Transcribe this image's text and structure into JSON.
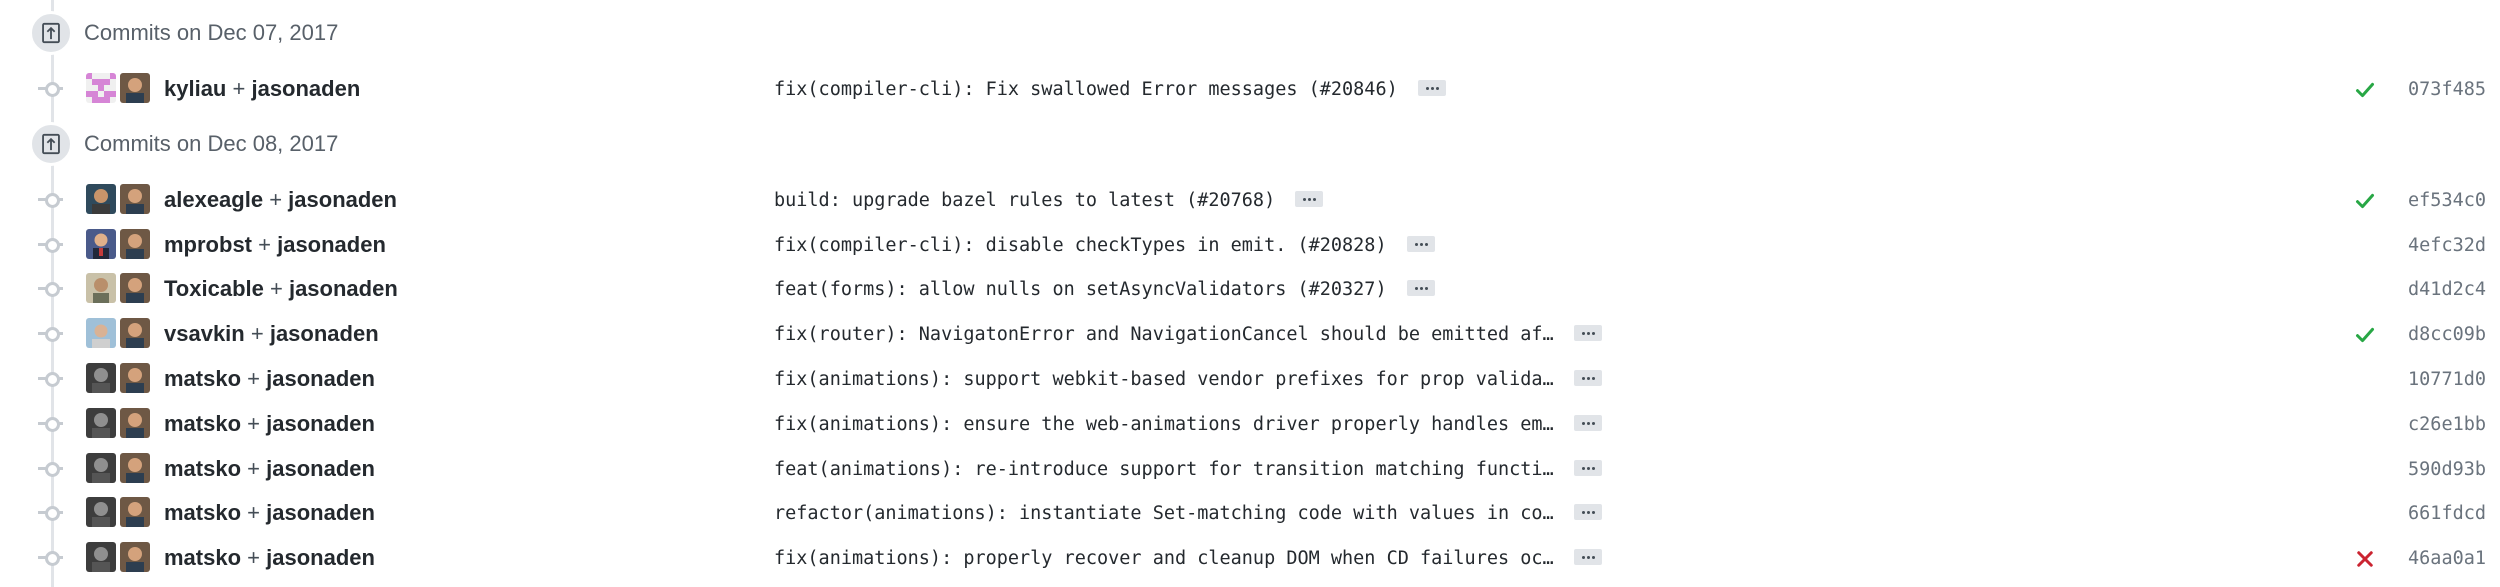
{
  "colors": {
    "success": "#28a745",
    "failure": "#cb2431"
  },
  "groups": [
    {
      "title": "Commits on Dec 07, 2017",
      "commits": [
        {
          "authors": [
            "kyliau",
            "jasonaden"
          ],
          "message": "fix(compiler-cli): Fix swallowed Error messages (#20846)",
          "status": "success",
          "sha": "073f485",
          "avatar1": "identicon-pink"
        }
      ]
    },
    {
      "title": "Commits on Dec 08, 2017",
      "commits": [
        {
          "authors": [
            "alexeagle",
            "jasonaden"
          ],
          "message": "build: upgrade bazel rules to latest (#20768)",
          "status": "success",
          "sha": "ef534c0",
          "avatar1": "photo-dark"
        },
        {
          "authors": [
            "mprobst",
            "jasonaden"
          ],
          "message": "fix(compiler-cli): disable checkTypes in emit. (#20828)",
          "status": "none",
          "sha": "4efc32d",
          "avatar1": "photo-suit"
        },
        {
          "authors": [
            "Toxicable",
            "jasonaden"
          ],
          "message": "feat(forms): allow nulls on setAsyncValidators (#20327)",
          "status": "none",
          "sha": "d41d2c4",
          "avatar1": "photo-light"
        },
        {
          "authors": [
            "vsavkin",
            "jasonaden"
          ],
          "message": "fix(router): NavigatonError and NavigationCancel should be emitted af…",
          "status": "success",
          "sha": "d8cc09b",
          "avatar1": "photo-outdoor"
        },
        {
          "authors": [
            "matsko",
            "jasonaden"
          ],
          "message": "fix(animations): support webkit-based vendor prefixes for prop valida…",
          "status": "none",
          "sha": "10771d0",
          "avatar1": "photo-gray"
        },
        {
          "authors": [
            "matsko",
            "jasonaden"
          ],
          "message": "fix(animations): ensure the web-animations driver properly handles em…",
          "status": "none",
          "sha": "c26e1bb",
          "avatar1": "photo-gray"
        },
        {
          "authors": [
            "matsko",
            "jasonaden"
          ],
          "message": "feat(animations): re-introduce support for transition matching functi…",
          "status": "none",
          "sha": "590d93b",
          "avatar1": "photo-gray"
        },
        {
          "authors": [
            "matsko",
            "jasonaden"
          ],
          "message": "refactor(animations): instantiate Set-matching code with values in co…",
          "status": "none",
          "sha": "661fdcd",
          "avatar1": "photo-gray"
        },
        {
          "authors": [
            "matsko",
            "jasonaden"
          ],
          "message": "fix(animations): properly recover and cleanup DOM when CD failures oc…",
          "status": "failure",
          "sha": "46aa0a1",
          "avatar1": "photo-gray"
        }
      ]
    }
  ]
}
